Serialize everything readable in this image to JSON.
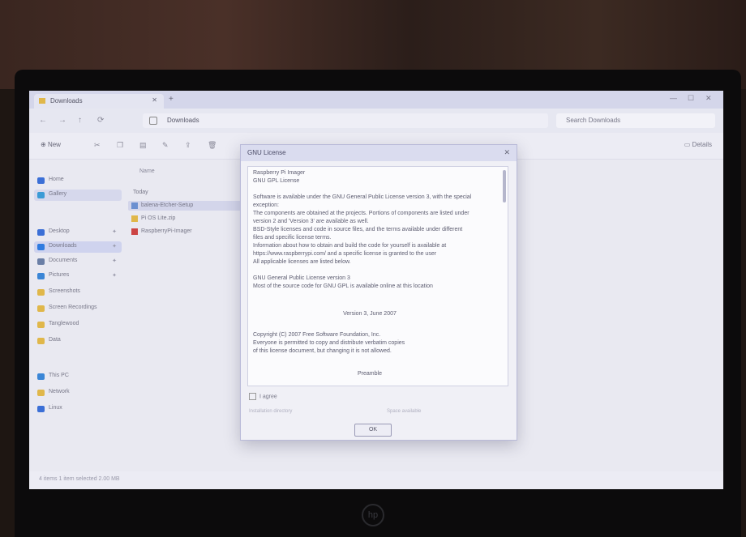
{
  "explorer": {
    "tab_title": "Downloads",
    "breadcrumb": "Downloads",
    "search_placeholder": "Search Downloads",
    "new_label": "New",
    "details_label": "Details",
    "column_name": "Name",
    "status": "4 items   1 item selected  2.00 MB"
  },
  "sidebar": {
    "items": [
      {
        "label": "Home",
        "icon": "home-icon",
        "color": "#3b6fd6"
      },
      {
        "label": "Gallery",
        "icon": "gallery-icon",
        "color": "#3b9bd6",
        "selected": true
      },
      {
        "label": "Desktop",
        "icon": "desktop-icon",
        "color": "#3b6fd6"
      },
      {
        "label": "Downloads",
        "icon": "download-icon",
        "color": "#2f7be0",
        "selected": true
      },
      {
        "label": "Documents",
        "icon": "document-icon",
        "color": "#6b7fa6"
      },
      {
        "label": "Pictures",
        "icon": "picture-icon",
        "color": "#3b86d6"
      },
      {
        "label": "Screenshots",
        "icon": "folder-icon",
        "color": "#e0b74a"
      },
      {
        "label": "Screen Recordings",
        "icon": "folder-icon",
        "color": "#e0b74a"
      },
      {
        "label": "Tanglewood",
        "icon": "folder-icon",
        "color": "#e0b74a"
      },
      {
        "label": "Data",
        "icon": "folder-icon",
        "color": "#e0b74a"
      },
      {
        "label": "This PC",
        "icon": "pc-icon",
        "color": "#3b86d6"
      },
      {
        "label": "Network",
        "icon": "network-icon",
        "color": "#e0b74a"
      },
      {
        "label": "Linux",
        "icon": "linux-icon",
        "color": "#3b6fd6"
      }
    ]
  },
  "files": [
    {
      "label": "Today"
    },
    {
      "label": "balena-Etcher-Setup",
      "selected": true
    },
    {
      "label": "Pi OS Lite.zip"
    },
    {
      "label": "RaspberryPi-Imager"
    }
  ],
  "dialog": {
    "title": "GNU License",
    "license_lines": [
      "Raspberry Pi Imager",
      "GNU GPL License",
      "",
      "Software is available under the GNU General Public License version 3, with the special",
      "exception:",
      "The components are obtained at the projects. Portions of components are listed under",
      "version 2 and 'Version 3' are available as well.",
      "BSD-Style licenses and code in source files, and the terms available under different",
      "files and specific license terms.",
      "Information about how to obtain and build the code for yourself is available at",
      "https://www.raspberrypi.com/ and a specific license is granted to the user",
      "All applicable licenses are listed below.",
      "",
      "GNU General Public License version 3",
      "Most of the source code for GNU GPL is available online at this location"
    ],
    "center_lines": [
      "Version 3, June 2007",
      "",
      "Copyright (C) 2007 Free Software Foundation, Inc.",
      "Everyone is permitted to copy and distribute verbatim copies",
      "of this license document, but changing it is not allowed.",
      "",
      "Preamble"
    ],
    "agree_label": "I agree",
    "footer_left": "Installation directory",
    "footer_right": "Space available",
    "ok_label": "OK"
  },
  "monitor": {
    "brand": "hp"
  }
}
